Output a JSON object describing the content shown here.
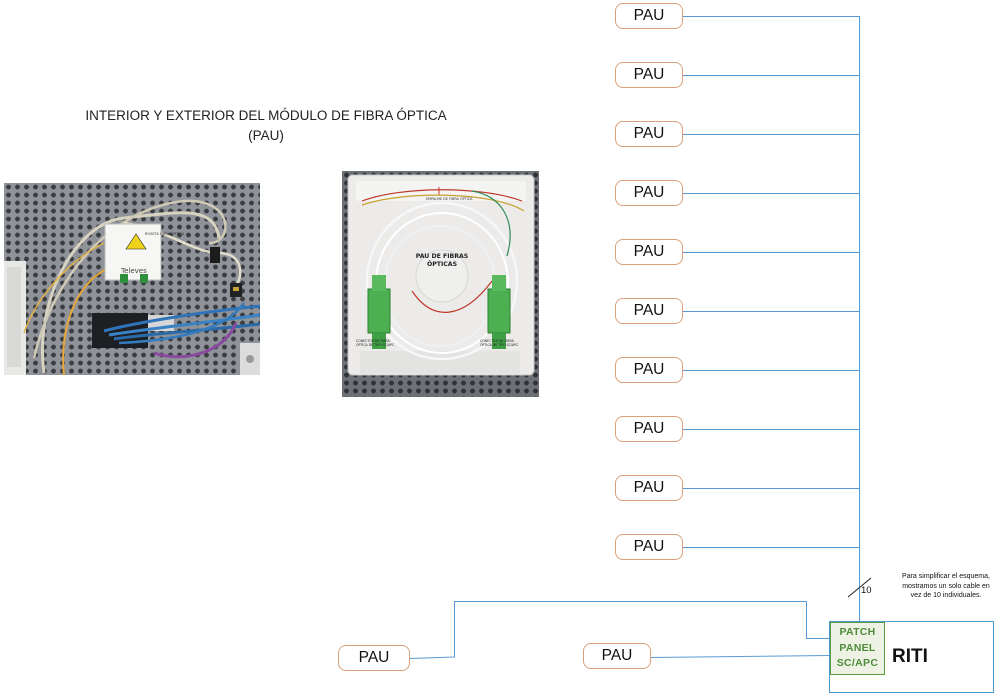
{
  "title": {
    "line1": "INTERIOR Y EXTERIOR DEL MÓDULO DE FIBRA ÓPTICA",
    "line2": "(PAU)"
  },
  "pau_label": "PAU",
  "riti": {
    "patch_line1": "PATCH",
    "patch_line2": "PANEL",
    "patch_line3": "SC/APC",
    "label": "RITI"
  },
  "cable_count": "10",
  "note": "Para simplificar el esquema, mostramos un solo cable en vez de 10 individuales.",
  "photo1": {
    "brand": "Televes",
    "small_label": "ROSETA FIBRA ÓPTICA"
  },
  "photo2": {
    "top_label": "EMPALME DE FIBRA ÓPTICA",
    "center_label_line1": "PAU DE FIBRAS",
    "center_label_line2": "ÓPTICAS",
    "left_label_line1": "CONECTOR DE FIBRA",
    "left_label_line2": "ÓPTICA DE TIPO SC/APC",
    "right_label_line1": "CONECTOR DE FIBRA",
    "right_label_line2": "ÓPTICA DE TIPO SC/APC"
  },
  "colors": {
    "wire": "#5b9bd5",
    "pau_border": "#d9a07a",
    "patch_green": "#4e8c3a",
    "connector_green": "#4caf50"
  }
}
